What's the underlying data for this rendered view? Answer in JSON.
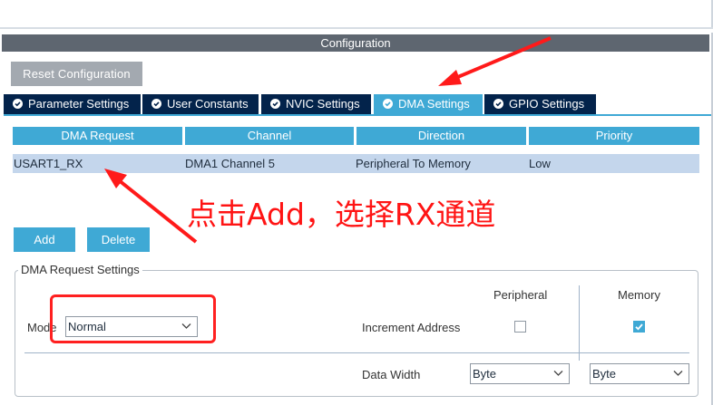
{
  "panel": {
    "title": "Configuration"
  },
  "toolbar": {
    "reset_label": "Reset Configuration"
  },
  "tabs": [
    {
      "label": "Parameter Settings"
    },
    {
      "label": "User Constants"
    },
    {
      "label": "NVIC Settings"
    },
    {
      "label": "DMA Settings"
    },
    {
      "label": "GPIO Settings"
    }
  ],
  "table": {
    "headers": [
      "DMA Request",
      "Channel",
      "Direction",
      "Priority"
    ],
    "rows": [
      [
        "USART1_RX",
        "DMA1 Channel 5",
        "Peripheral To Memory",
        "Low"
      ]
    ]
  },
  "actions": {
    "add_label": "Add",
    "delete_label": "Delete"
  },
  "settings": {
    "legend": "DMA Request Settings",
    "peripheral_header": "Peripheral",
    "memory_header": "Memory",
    "mode_label": "Mode",
    "mode_value": "Normal",
    "increment_label": "Increment Address",
    "peripheral_increment": false,
    "memory_increment": true,
    "data_width_label": "Data Width",
    "peripheral_width": "Byte",
    "memory_width": "Byte"
  },
  "annotation": {
    "text": "点击Add，选择RX通道"
  },
  "colors": {
    "accent": "#3fa9d5",
    "tab_dark": "#03234b",
    "header_gray": "#5e6670",
    "annotation_red": "#ff1414",
    "row_selected": "#c4d6ec"
  },
  "icons": {
    "tab": "check-circle-icon",
    "dropdown": "chevron-down-icon"
  }
}
